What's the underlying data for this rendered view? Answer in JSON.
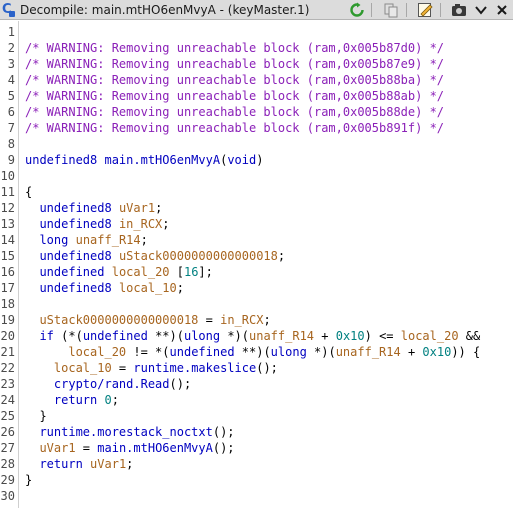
{
  "window": {
    "title": "Decompile: main.mtHO6enMvyA - (keyMaster.1)",
    "icons": [
      "decompile-icon",
      "refresh-icon",
      "copy-icon",
      "edit-icon",
      "snapshot-icon",
      "chevron-down-icon"
    ]
  },
  "lines": [
    {
      "n": "1",
      "segs": []
    },
    {
      "n": "2",
      "segs": [
        {
          "c": "cm",
          "t": "/* WARNING: Removing unreachable block (ram,0x005b87d0) */"
        }
      ]
    },
    {
      "n": "3",
      "segs": [
        {
          "c": "cm",
          "t": "/* WARNING: Removing unreachable block (ram,0x005b87e9) */"
        }
      ]
    },
    {
      "n": "4",
      "segs": [
        {
          "c": "cm",
          "t": "/* WARNING: Removing unreachable block (ram,0x005b88ba) */"
        }
      ]
    },
    {
      "n": "5",
      "segs": [
        {
          "c": "cm",
          "t": "/* WARNING: Removing unreachable block (ram,0x005b88ab) */"
        }
      ]
    },
    {
      "n": "6",
      "segs": [
        {
          "c": "cm",
          "t": "/* WARNING: Removing unreachable block (ram,0x005b88de) */"
        }
      ]
    },
    {
      "n": "7",
      "segs": [
        {
          "c": "cm",
          "t": "/* WARNING: Removing unreachable block (ram,0x005b891f) */"
        }
      ]
    },
    {
      "n": "8",
      "segs": []
    },
    {
      "n": "9",
      "segs": [
        {
          "c": "ty",
          "t": "undefined8"
        },
        {
          "c": "pl",
          "t": " "
        },
        {
          "c": "fn",
          "t": "main.mtHO6enMvyA"
        },
        {
          "c": "pl",
          "t": "("
        },
        {
          "c": "ty",
          "t": "void"
        },
        {
          "c": "pl",
          "t": ")"
        }
      ]
    },
    {
      "n": "10",
      "segs": []
    },
    {
      "n": "11",
      "segs": [
        {
          "c": "pl",
          "t": "{"
        }
      ]
    },
    {
      "n": "12",
      "segs": [
        {
          "c": "pl",
          "t": "  "
        },
        {
          "c": "ty",
          "t": "undefined8"
        },
        {
          "c": "pl",
          "t": " "
        },
        {
          "c": "var",
          "t": "uVar1"
        },
        {
          "c": "pl",
          "t": ";"
        }
      ]
    },
    {
      "n": "13",
      "segs": [
        {
          "c": "pl",
          "t": "  "
        },
        {
          "c": "ty",
          "t": "undefined8"
        },
        {
          "c": "pl",
          "t": " "
        },
        {
          "c": "var",
          "t": "in_RCX"
        },
        {
          "c": "pl",
          "t": ";"
        }
      ]
    },
    {
      "n": "14",
      "segs": [
        {
          "c": "pl",
          "t": "  "
        },
        {
          "c": "ty",
          "t": "long"
        },
        {
          "c": "pl",
          "t": " "
        },
        {
          "c": "var",
          "t": "unaff_R14"
        },
        {
          "c": "pl",
          "t": ";"
        }
      ]
    },
    {
      "n": "15",
      "segs": [
        {
          "c": "pl",
          "t": "  "
        },
        {
          "c": "ty",
          "t": "undefined8"
        },
        {
          "c": "pl",
          "t": " "
        },
        {
          "c": "var",
          "t": "uStack0000000000000018"
        },
        {
          "c": "pl",
          "t": ";"
        }
      ]
    },
    {
      "n": "16",
      "segs": [
        {
          "c": "pl",
          "t": "  "
        },
        {
          "c": "ty",
          "t": "undefined"
        },
        {
          "c": "pl",
          "t": " "
        },
        {
          "c": "var",
          "t": "local_20"
        },
        {
          "c": "pl",
          "t": " ["
        },
        {
          "c": "num",
          "t": "16"
        },
        {
          "c": "pl",
          "t": "];"
        }
      ]
    },
    {
      "n": "17",
      "segs": [
        {
          "c": "pl",
          "t": "  "
        },
        {
          "c": "ty",
          "t": "undefined8"
        },
        {
          "c": "pl",
          "t": " "
        },
        {
          "c": "var",
          "t": "local_10"
        },
        {
          "c": "pl",
          "t": ";"
        }
      ]
    },
    {
      "n": "18",
      "segs": [
        {
          "c": "pl",
          "t": "  "
        }
      ]
    },
    {
      "n": "19",
      "segs": [
        {
          "c": "pl",
          "t": "  "
        },
        {
          "c": "var",
          "t": "uStack0000000000000018"
        },
        {
          "c": "pl",
          "t": " = "
        },
        {
          "c": "var",
          "t": "in_RCX"
        },
        {
          "c": "pl",
          "t": ";"
        }
      ]
    },
    {
      "n": "20",
      "segs": [
        {
          "c": "pl",
          "t": "  "
        },
        {
          "c": "kw",
          "t": "if"
        },
        {
          "c": "pl",
          "t": " (*("
        },
        {
          "c": "ty",
          "t": "undefined"
        },
        {
          "c": "pl",
          "t": " **)("
        },
        {
          "c": "ty",
          "t": "ulong"
        },
        {
          "c": "pl",
          "t": " *)("
        },
        {
          "c": "var",
          "t": "unaff_R14"
        },
        {
          "c": "pl",
          "t": " + "
        },
        {
          "c": "num",
          "t": "0x10"
        },
        {
          "c": "pl",
          "t": ") <= "
        },
        {
          "c": "var",
          "t": "local_20"
        },
        {
          "c": "pl",
          "t": " &&"
        }
      ]
    },
    {
      "n": "21",
      "segs": [
        {
          "c": "pl",
          "t": "      "
        },
        {
          "c": "var",
          "t": "local_20"
        },
        {
          "c": "pl",
          "t": " != *("
        },
        {
          "c": "ty",
          "t": "undefined"
        },
        {
          "c": "pl",
          "t": " **)("
        },
        {
          "c": "ty",
          "t": "ulong"
        },
        {
          "c": "pl",
          "t": " *)("
        },
        {
          "c": "var",
          "t": "unaff_R14"
        },
        {
          "c": "pl",
          "t": " + "
        },
        {
          "c": "num",
          "t": "0x10"
        },
        {
          "c": "pl",
          "t": ")) {"
        }
      ]
    },
    {
      "n": "22",
      "segs": [
        {
          "c": "pl",
          "t": "    "
        },
        {
          "c": "var",
          "t": "local_10"
        },
        {
          "c": "pl",
          "t": " = "
        },
        {
          "c": "fn",
          "t": "runtime.makeslice"
        },
        {
          "c": "pl",
          "t": "();"
        }
      ]
    },
    {
      "n": "23",
      "segs": [
        {
          "c": "pl",
          "t": "    "
        },
        {
          "c": "fn",
          "t": "crypto/rand.Read"
        },
        {
          "c": "pl",
          "t": "();"
        }
      ]
    },
    {
      "n": "24",
      "segs": [
        {
          "c": "pl",
          "t": "    "
        },
        {
          "c": "kw",
          "t": "return"
        },
        {
          "c": "pl",
          "t": " "
        },
        {
          "c": "num",
          "t": "0"
        },
        {
          "c": "pl",
          "t": ";"
        }
      ]
    },
    {
      "n": "25",
      "segs": [
        {
          "c": "pl",
          "t": "  }"
        }
      ]
    },
    {
      "n": "26",
      "segs": [
        {
          "c": "pl",
          "t": "  "
        },
        {
          "c": "fn",
          "t": "runtime.morestack_noctxt"
        },
        {
          "c": "pl",
          "t": "();"
        }
      ]
    },
    {
      "n": "27",
      "segs": [
        {
          "c": "pl",
          "t": "  "
        },
        {
          "c": "var",
          "t": "uVar1"
        },
        {
          "c": "pl",
          "t": " = "
        },
        {
          "c": "fn",
          "t": "main.mtHO6enMvyA"
        },
        {
          "c": "pl",
          "t": "();"
        }
      ]
    },
    {
      "n": "28",
      "segs": [
        {
          "c": "pl",
          "t": "  "
        },
        {
          "c": "kw",
          "t": "return"
        },
        {
          "c": "pl",
          "t": " "
        },
        {
          "c": "var",
          "t": "uVar1"
        },
        {
          "c": "pl",
          "t": ";"
        }
      ]
    },
    {
      "n": "29",
      "segs": [
        {
          "c": "pl",
          "t": "}"
        }
      ]
    },
    {
      "n": "30",
      "segs": []
    }
  ]
}
